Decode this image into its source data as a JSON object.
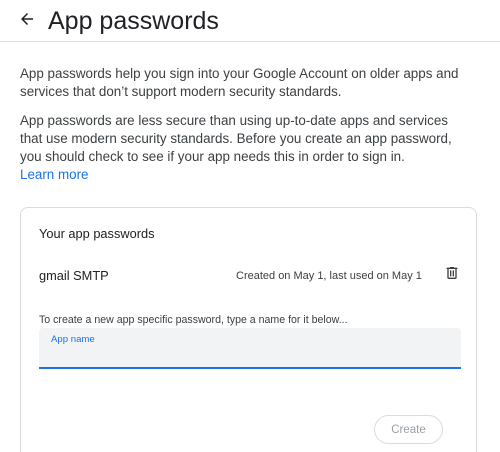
{
  "header": {
    "title": "App passwords",
    "back_icon": "arrow-back-icon"
  },
  "intro": {
    "paragraph1": "App passwords help you sign into your Google Account on older apps and services that don’t support modern security standards.",
    "paragraph2": "App passwords are less secure than using up-to-date apps and services that use modern security standards. Before you create an app password, you should check to see if your app needs this in order to sign in.",
    "learn_more": "Learn more"
  },
  "card": {
    "title": "Your app passwords",
    "passwords": [
      {
        "name": "gmail SMTP",
        "meta": "Created on May 1, last used on May 1",
        "delete_icon": "trash-icon"
      }
    ],
    "helper_text": "To create a new app specific password, type a name for it below...",
    "field": {
      "label": "App name",
      "value": ""
    },
    "create_label": "Create"
  },
  "colors": {
    "accent": "#1a73e8",
    "border": "#dadce0",
    "field_bg": "#f1f3f4",
    "text": "#202124",
    "disabled_text": "#9aa0a6"
  }
}
